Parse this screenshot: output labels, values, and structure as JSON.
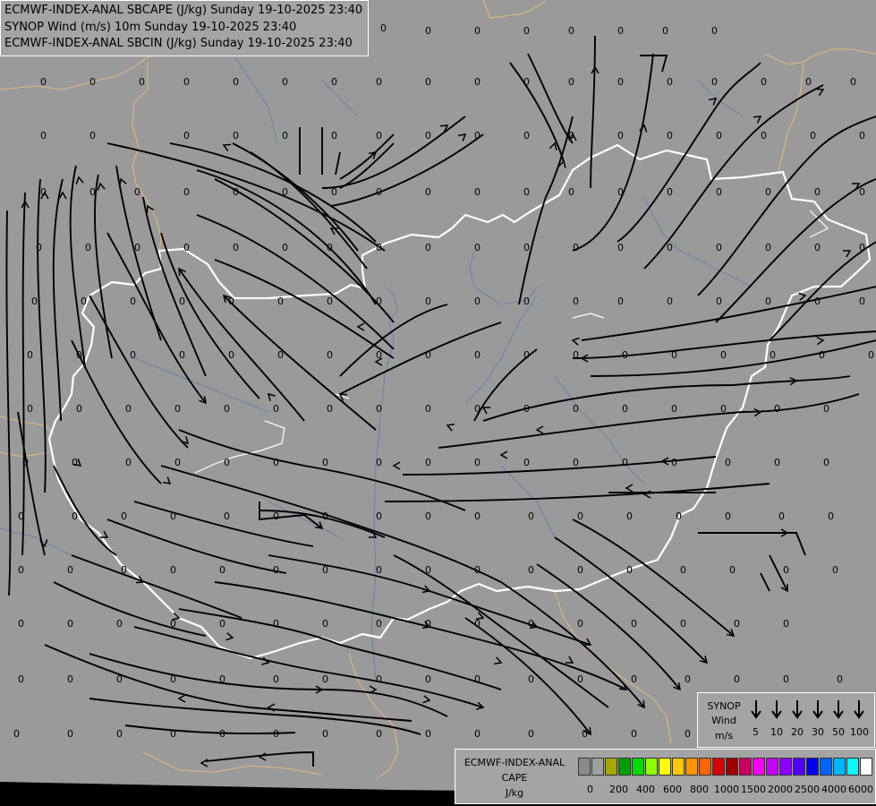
{
  "titles": [
    "ECMWF-INDEX-ANAL SBCAPE (J/kg) Sunday 19-10-2025 23:40",
    "SYNOP Wind (m/s) 10m Sunday 19-10-2025 23:40",
    "ECMWF-INDEX-ANAL SBCIN (J/kg) Sunday 19-10-2025 23:40"
  ],
  "value_label": "0",
  "synop_legend": {
    "title": "SYNOP",
    "subtitle": "Wind",
    "unit": "m/s",
    "speeds": [
      "5",
      "10",
      "20",
      "30",
      "50",
      "100"
    ]
  },
  "cape_legend": {
    "title_line1": "ECMWF-INDEX-ANAL",
    "title_line2": "CAPE",
    "unit": "J/kg",
    "colors": [
      "#8a8a8a",
      "#a0a0a0",
      "#a6a600",
      "#00a000",
      "#00dd00",
      "#90ff00",
      "#ffff00",
      "#ffc800",
      "#ff9600",
      "#ff6400",
      "#dc0000",
      "#a00000",
      "#c80064",
      "#ff00ff",
      "#c800ff",
      "#8c00ff",
      "#5000ff",
      "#0000ff",
      "#0064ff",
      "#00b4ff",
      "#00ffff",
      "#ffffff"
    ],
    "ticks": [
      "0",
      "200",
      "400",
      "600",
      "800",
      "1000",
      "1500",
      "2000",
      "2500",
      "4000",
      "6000"
    ]
  },
  "colors": {
    "background": "#9a9a9a",
    "border_country": "#ffffff",
    "border_region": "#d2b482",
    "river": "#6b82a8",
    "streamline": "#000000",
    "value_text": "#000000"
  }
}
